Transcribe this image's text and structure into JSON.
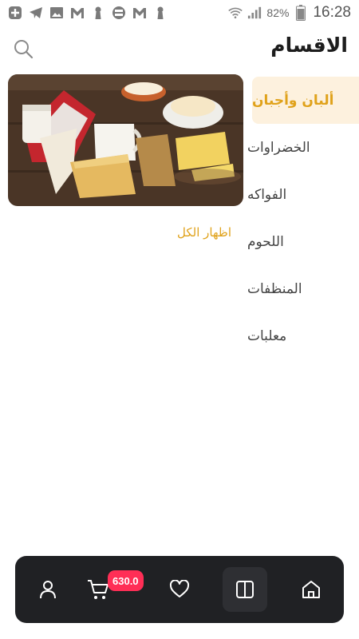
{
  "status_bar": {
    "battery": "82%",
    "time": "16:28",
    "left_icons": [
      "add-app-icon",
      "telegram-icon",
      "image-icon",
      "gmail-icon",
      "keyhole-icon",
      "circle-app-icon",
      "gmail-icon",
      "keyhole-icon"
    ],
    "right_icons": [
      "wifi-icon",
      "signal-icon",
      "battery-icon"
    ]
  },
  "header": {
    "title": "الاقسام",
    "search_icon": "search-icon"
  },
  "categories": [
    {
      "label": "ألبان وأجبان",
      "active": true
    },
    {
      "label": "الخضراوات",
      "active": false
    },
    {
      "label": "الفواكه",
      "active": false
    },
    {
      "label": "اللحوم",
      "active": false
    },
    {
      "label": "المنظفات",
      "active": false
    },
    {
      "label": "معلبات",
      "active": false
    }
  ],
  "content": {
    "show_all": "اظهار الكل"
  },
  "bottom_nav": {
    "items": [
      {
        "icon": "user-icon"
      },
      {
        "icon": "cart-icon",
        "badge": "630.0"
      },
      {
        "icon": "heart-icon"
      },
      {
        "icon": "columns-icon",
        "active": true
      },
      {
        "icon": "home-icon"
      }
    ]
  },
  "colors": {
    "accent": "#e0a21b",
    "active_bg": "#fdf1de",
    "nav_bg": "#202124",
    "badge": "#ff2e56"
  }
}
